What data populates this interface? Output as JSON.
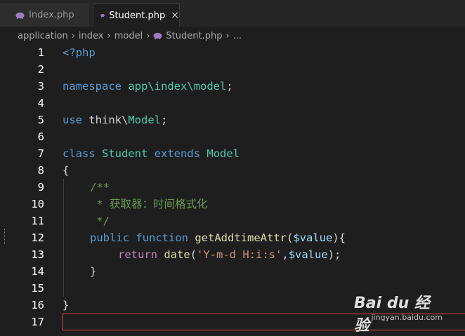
{
  "tabs": [
    {
      "label": "Index.php",
      "active": false
    },
    {
      "label": "Student.php",
      "active": true,
      "close": "×"
    }
  ],
  "breadcrumb": {
    "parts": [
      "application",
      "index",
      "model",
      "Student.php",
      "..."
    ],
    "sep": "›"
  },
  "editor": {
    "line_numbers": [
      "1",
      "2",
      "3",
      "4",
      "5",
      "6",
      "7",
      "8",
      "9",
      "10",
      "11",
      "12",
      "13",
      "14",
      "15",
      "16",
      "17"
    ],
    "lines": {
      "l1": {
        "open": "<?php"
      },
      "l3": {
        "kw": "namespace",
        "ns": "app\\index\\model",
        "semi": ";"
      },
      "l5": {
        "kw": "use",
        "ns1": "think\\",
        "cls": "Model",
        "semi": ";"
      },
      "l7": {
        "kw1": "class",
        "cls1": "Student",
        "kw2": "extends",
        "cls2": "Model"
      },
      "l8": {
        "text": "{"
      },
      "l9": {
        "text": "/**"
      },
      "l10": {
        "text": " * 获取器：时间格式化"
      },
      "l11": {
        "text": " */"
      },
      "l12": {
        "kw1": "public",
        "kw2": "function",
        "fn": "getAddtimeAttr",
        "p1": "(",
        "var": "$value",
        "p2": "){"
      },
      "l13": {
        "kw": "return",
        "fn": "date",
        "p1": "(",
        "str": "'Y-m-d H:i:s'",
        "comma": ",",
        "var": "$value",
        "p2": ");"
      },
      "l14": {
        "text": "}"
      },
      "l16": {
        "text": "}"
      }
    }
  },
  "watermark": {
    "brand": "Bai du 经验",
    "url": "jingyan.baidu.com"
  },
  "colors": {
    "keyword": "#569cd6",
    "control": "#c586c0",
    "function": "#dcdcaa",
    "class": "#4ec9b0",
    "variable": "#9cdcfe",
    "string": "#ce9178",
    "comment": "#6a9955"
  },
  "icons": {
    "php_file": "php-elephant-icon"
  }
}
